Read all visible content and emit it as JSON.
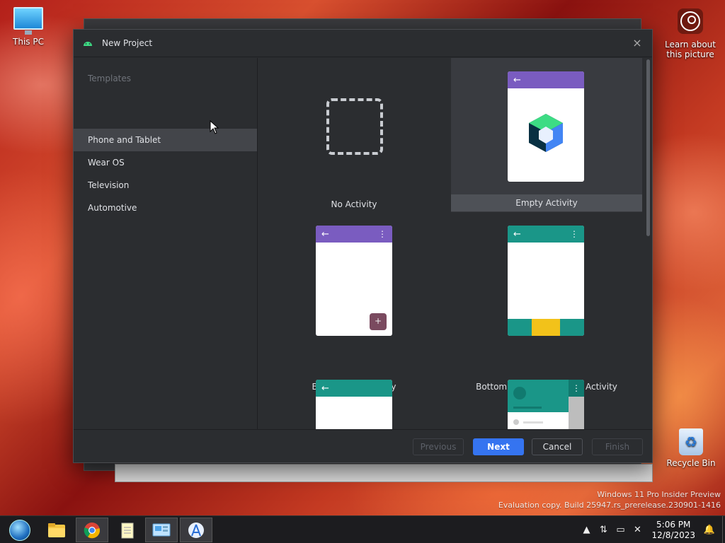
{
  "desktop": {
    "icons": [
      {
        "label": "This PC",
        "icon": "monitor-icon"
      },
      {
        "label": "Learn about this picture",
        "icon": "camera-circle-icon"
      },
      {
        "label": "Recycle Bin",
        "icon": "recycle-bin-icon"
      }
    ],
    "watermark": {
      "line1": "Windows 11 Pro Insider Preview",
      "line2": "Evaluation copy. Build 25947.rs_prerelease.230901-1416"
    }
  },
  "dialog": {
    "title": "New Project",
    "close_icon": "×",
    "sidebar": {
      "section_label": "Templates",
      "items": [
        {
          "label": "Phone and Tablet",
          "active": true
        },
        {
          "label": "Wear OS",
          "active": false
        },
        {
          "label": "Television",
          "active": false
        },
        {
          "label": "Automotive",
          "active": false
        }
      ]
    },
    "templates": [
      {
        "label": "No Activity",
        "selected": false
      },
      {
        "label": "Empty Activity",
        "selected": true
      },
      {
        "label": "Basic Views Activity",
        "selected": false
      },
      {
        "label": "Bottom Navigation Views Activity",
        "selected": false
      },
      {
        "label": "",
        "selected": false
      },
      {
        "label": "",
        "selected": false
      }
    ],
    "glyphs": {
      "back": "←",
      "menu": "⋮",
      "plus": "+"
    },
    "buttons": {
      "previous": "Previous",
      "next": "Next",
      "cancel": "Cancel",
      "finish": "Finish"
    }
  },
  "taskbar": {
    "apps": [
      "start-icon",
      "file-explorer-icon",
      "chrome-icon",
      "notepad-icon",
      "control-panel-icon",
      "android-studio-icon"
    ],
    "tray": {
      "time": "5:06 PM",
      "date": "12/8/2023"
    }
  },
  "colors": {
    "accent": "#3574f0",
    "purple_bar": "#7a5cc0",
    "teal_bar": "#1a9688",
    "nav_highlight": "#f2c21a"
  }
}
